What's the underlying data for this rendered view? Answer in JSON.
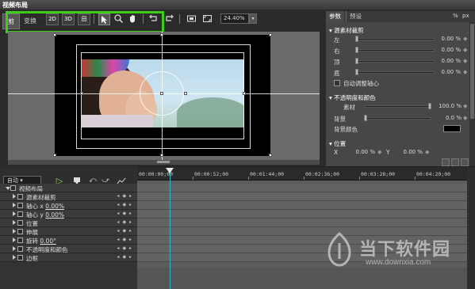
{
  "window": {
    "title": "视频布局"
  },
  "left_tabs": [
    {
      "label": "剪"
    },
    {
      "label": "变换"
    }
  ],
  "toolbar": {
    "btn_2d": "2D",
    "btn_3d": "3D",
    "btn_grid": "田",
    "zoom": "24.40%",
    "zoom_arrow": "▾",
    "icons": [
      "arrow-cursor-icon",
      "magnifier-icon",
      "hand-icon",
      "undo-icon",
      "redo-icon",
      "fit-frame-icon",
      "fullscreen-icon"
    ]
  },
  "right_panel": {
    "tabs": [
      {
        "label": "参数"
      },
      {
        "label": "预设"
      }
    ],
    "unit_pct": "%",
    "unit_px": "px",
    "crop_section": "源素材裁剪",
    "crop_rows": [
      {
        "label": "左",
        "value": "0.00 %"
      },
      {
        "label": "右",
        "value": "0.00 %"
      },
      {
        "label": "顶",
        "value": "0.00 %"
      },
      {
        "label": "底",
        "value": "0.00 %"
      }
    ],
    "auto_anchor": "自动调整轴心",
    "opacity_section": "不透明度和颜色",
    "opacity_rows": [
      {
        "label": "素材",
        "value": "100.0 %"
      },
      {
        "label": "背景",
        "value": "0.0 %"
      }
    ],
    "bg_color_label": "背景颜色",
    "position_section": "位置",
    "pos_x_label": "X",
    "pos_x_value": "0.00 %",
    "pos_y_label": "Y",
    "pos_y_value": "0.00 %",
    "colors": {
      "accent_green": "#3dcc1c",
      "playhead": "#35b4c4"
    }
  },
  "timeline": {
    "mode": "自动",
    "mode_arrow": "▾",
    "ruler_labels": [
      "00:00:00;00",
      "00:00:52;00",
      "00:01:44;00",
      "00:02:36;00",
      "00:03:28;00",
      "00:04:20;00"
    ],
    "tree": [
      {
        "label": "视频布局",
        "expanded": true
      },
      {
        "label": "源素材裁剪"
      },
      {
        "label_prefix": "轴心 x ",
        "label_value": "0.00%"
      },
      {
        "label_prefix": "轴心 y ",
        "label_value": "0.00%"
      },
      {
        "label": "位置"
      },
      {
        "label": "伸展"
      },
      {
        "label_prefix": "旋转 ",
        "label_value": "0.00°"
      },
      {
        "label": "不透明度和颜色"
      },
      {
        "label": "边框"
      }
    ],
    "key_controls": "◂ ◆ ▸"
  },
  "watermark": {
    "brand": "当下软件园",
    "url": "www.downxia.com"
  }
}
